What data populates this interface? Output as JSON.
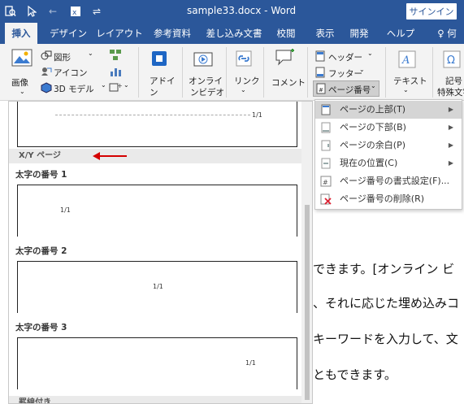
{
  "titlebar": {
    "title": "sample33.docx  -  Word",
    "signin": "サインイン",
    "qat_icons": [
      "search-icon",
      "pointer-icon",
      "back-icon",
      "word-icon",
      "customize-icon"
    ]
  },
  "tabs": [
    "挿入",
    "デザイン",
    "レイアウト",
    "参考資料",
    "差し込み文書",
    "校閲",
    "表示",
    "開発",
    "ヘルプ",
    "何"
  ],
  "active_tab": "挿入",
  "ribbon": {
    "image": "画像",
    "shapes": "図形",
    "icons": "アイコン",
    "model3d": "3D モデル",
    "addin": "アドイ\nン",
    "addin_l1": "アドイ",
    "addin_l2": "ン",
    "video_l1": "オンライ",
    "video_l2": "ンビデオ",
    "link": "リンク",
    "comment": "コメント",
    "header": "ヘッダー",
    "footer": "フッター",
    "page_number": "ページ番号",
    "text": "テキスト",
    "symbol_l1": "記号",
    "symbol_l2": "特殊文字"
  },
  "gallery": {
    "section_header": "X/Y ページ",
    "items": [
      {
        "label": "",
        "num": "1/1"
      },
      {
        "label": "太字の番号 1",
        "num": "1/1"
      },
      {
        "label": "太字の番号 2",
        "num": "1/1"
      },
      {
        "label": "太字の番号 3",
        "num": "1/1"
      }
    ],
    "next_header": "罫線付き"
  },
  "submenu": [
    {
      "label": "ページの上部(T)",
      "arrow": true,
      "highlight": true,
      "icon": "page-top-icon"
    },
    {
      "label": "ページの下部(B)",
      "arrow": true,
      "highlight": false,
      "icon": "page-bottom-icon"
    },
    {
      "label": "ページの余白(P)",
      "arrow": true,
      "highlight": false,
      "icon": "page-margin-icon"
    },
    {
      "label": "現在の位置(C)",
      "arrow": true,
      "highlight": false,
      "icon": "current-position-icon"
    },
    {
      "label": "ページ番号の書式設定(F)...",
      "arrow": false,
      "highlight": false,
      "icon": "format-page-number-icon"
    },
    {
      "label": "ページ番号の削除(R)",
      "arrow": false,
      "highlight": false,
      "icon": "remove-page-number-icon"
    }
  ],
  "document_lines": [
    "できます。[オンライン ビ",
    "、それに応じた埋め込みコ",
    "キーワードを入力して、文",
    "ともできます。"
  ],
  "colors": {
    "brand": "#2b579a",
    "annotation_arrow": "#d40000"
  }
}
